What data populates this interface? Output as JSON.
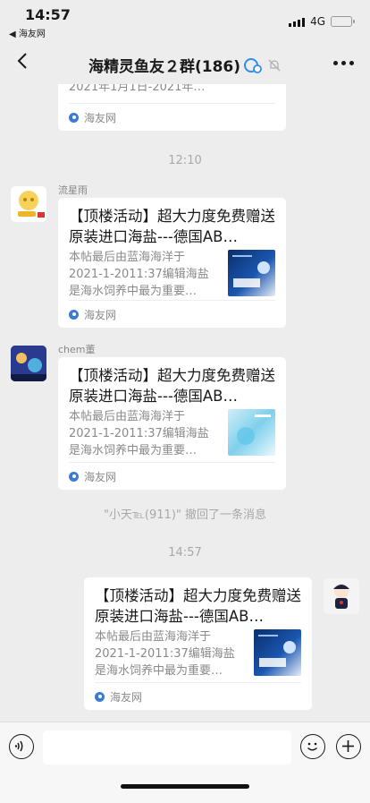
{
  "status": {
    "time": "14:57",
    "back_app": "◀ 海友网",
    "network": "4G"
  },
  "nav": {
    "title": "海精灵鱼友２群(186)"
  },
  "partial_card": {
    "desc_tail": "2021年1月1日-2021年…",
    "source": "海友网"
  },
  "time_sep_1": "12:10",
  "msg1": {
    "sender": "流星雨",
    "title": "【顶楼活动】超大力度免费赠送原装进口海盐---德国AB…",
    "desc": "本帖最后由蓝海海洋于2021-1-2011:37编辑海盐是海水饲养中最为重要…",
    "source": "海友网"
  },
  "msg2": {
    "sender": "chem董",
    "title": "【顶楼活动】超大力度免费赠送原装进口海盐---德国AB…",
    "desc": "本帖最后由蓝海海洋于2021-1-2011:37编辑海盐是海水饲养中最为重要…",
    "source": "海友网"
  },
  "recall": "\"小天℡(911)\" 撤回了一条消息",
  "time_sep_2": "14:57",
  "msg3": {
    "title": "【顶楼活动】超大力度免费赠送原装进口海盐---德国AB…",
    "desc": "本帖最后由蓝海海洋于2021-1-2011:37编辑海盐是海水饲养中最为重要…",
    "source": "海友网"
  },
  "input": {
    "value": ""
  },
  "colors": {
    "background": "#ededed",
    "card": "#ffffff",
    "meta_text": "#a8a8a8"
  }
}
